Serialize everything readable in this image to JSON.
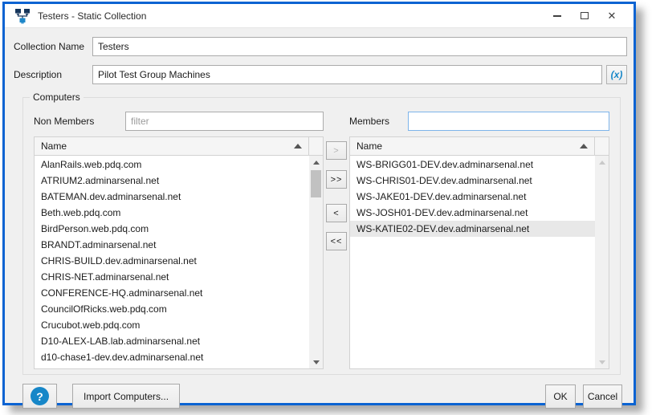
{
  "titlebar": {
    "title": "Testers - Static Collection",
    "close_glyph": "✕"
  },
  "fields": {
    "collection_name_label": "Collection Name",
    "collection_name_value": "Testers",
    "description_label": "Description",
    "description_value": "Pilot Test Group Machines",
    "insert_variable_label": "(x)"
  },
  "computers": {
    "group_label": "Computers",
    "non_members_label": "Non Members",
    "non_members_filter_placeholder": "filter",
    "members_label": "Members",
    "members_filter_value": "",
    "column_header": "Name",
    "non_members": [
      "AlanRails.web.pdq.com",
      "ATRIUM2.adminarsenal.net",
      "BATEMAN.dev.adminarsenal.net",
      "Beth.web.pdq.com",
      "BirdPerson.web.pdq.com",
      "BRANDT.adminarsenal.net",
      "CHRIS-BUILD.dev.adminarsenal.net",
      "CHRIS-NET.adminarsenal.net",
      "CONFERENCE-HQ.adminarsenal.net",
      "CouncilOfRicks.web.pdq.com",
      "Crucubot.web.pdq.com",
      "D10-ALEX-LAB.lab.adminarsenal.net",
      "d10-chase1-dev.dev.adminarsenal.net"
    ],
    "members": [
      "WS-BRIGG01-DEV.dev.adminarsenal.net",
      "WS-CHRIS01-DEV.dev.adminarsenal.net",
      "WS-JAKE01-DEV.dev.adminarsenal.net",
      "WS-JOSH01-DEV.dev.adminarsenal.net",
      "WS-KATIE02-DEV.dev.adminarsenal.net"
    ],
    "members_selected_index": 4,
    "transfer": {
      "add": ">",
      "add_all": ">>",
      "remove": "<",
      "remove_all": "<<"
    }
  },
  "footer": {
    "help_glyph": "?",
    "import_label": "Import Computers...",
    "ok_label": "OK",
    "cancel_label": "Cancel"
  },
  "colors": {
    "window_border": "#0b63d2",
    "focus_border": "#7eb4ea",
    "accent_blue": "#1787c8",
    "selection_bg": "#e8e8e8"
  }
}
